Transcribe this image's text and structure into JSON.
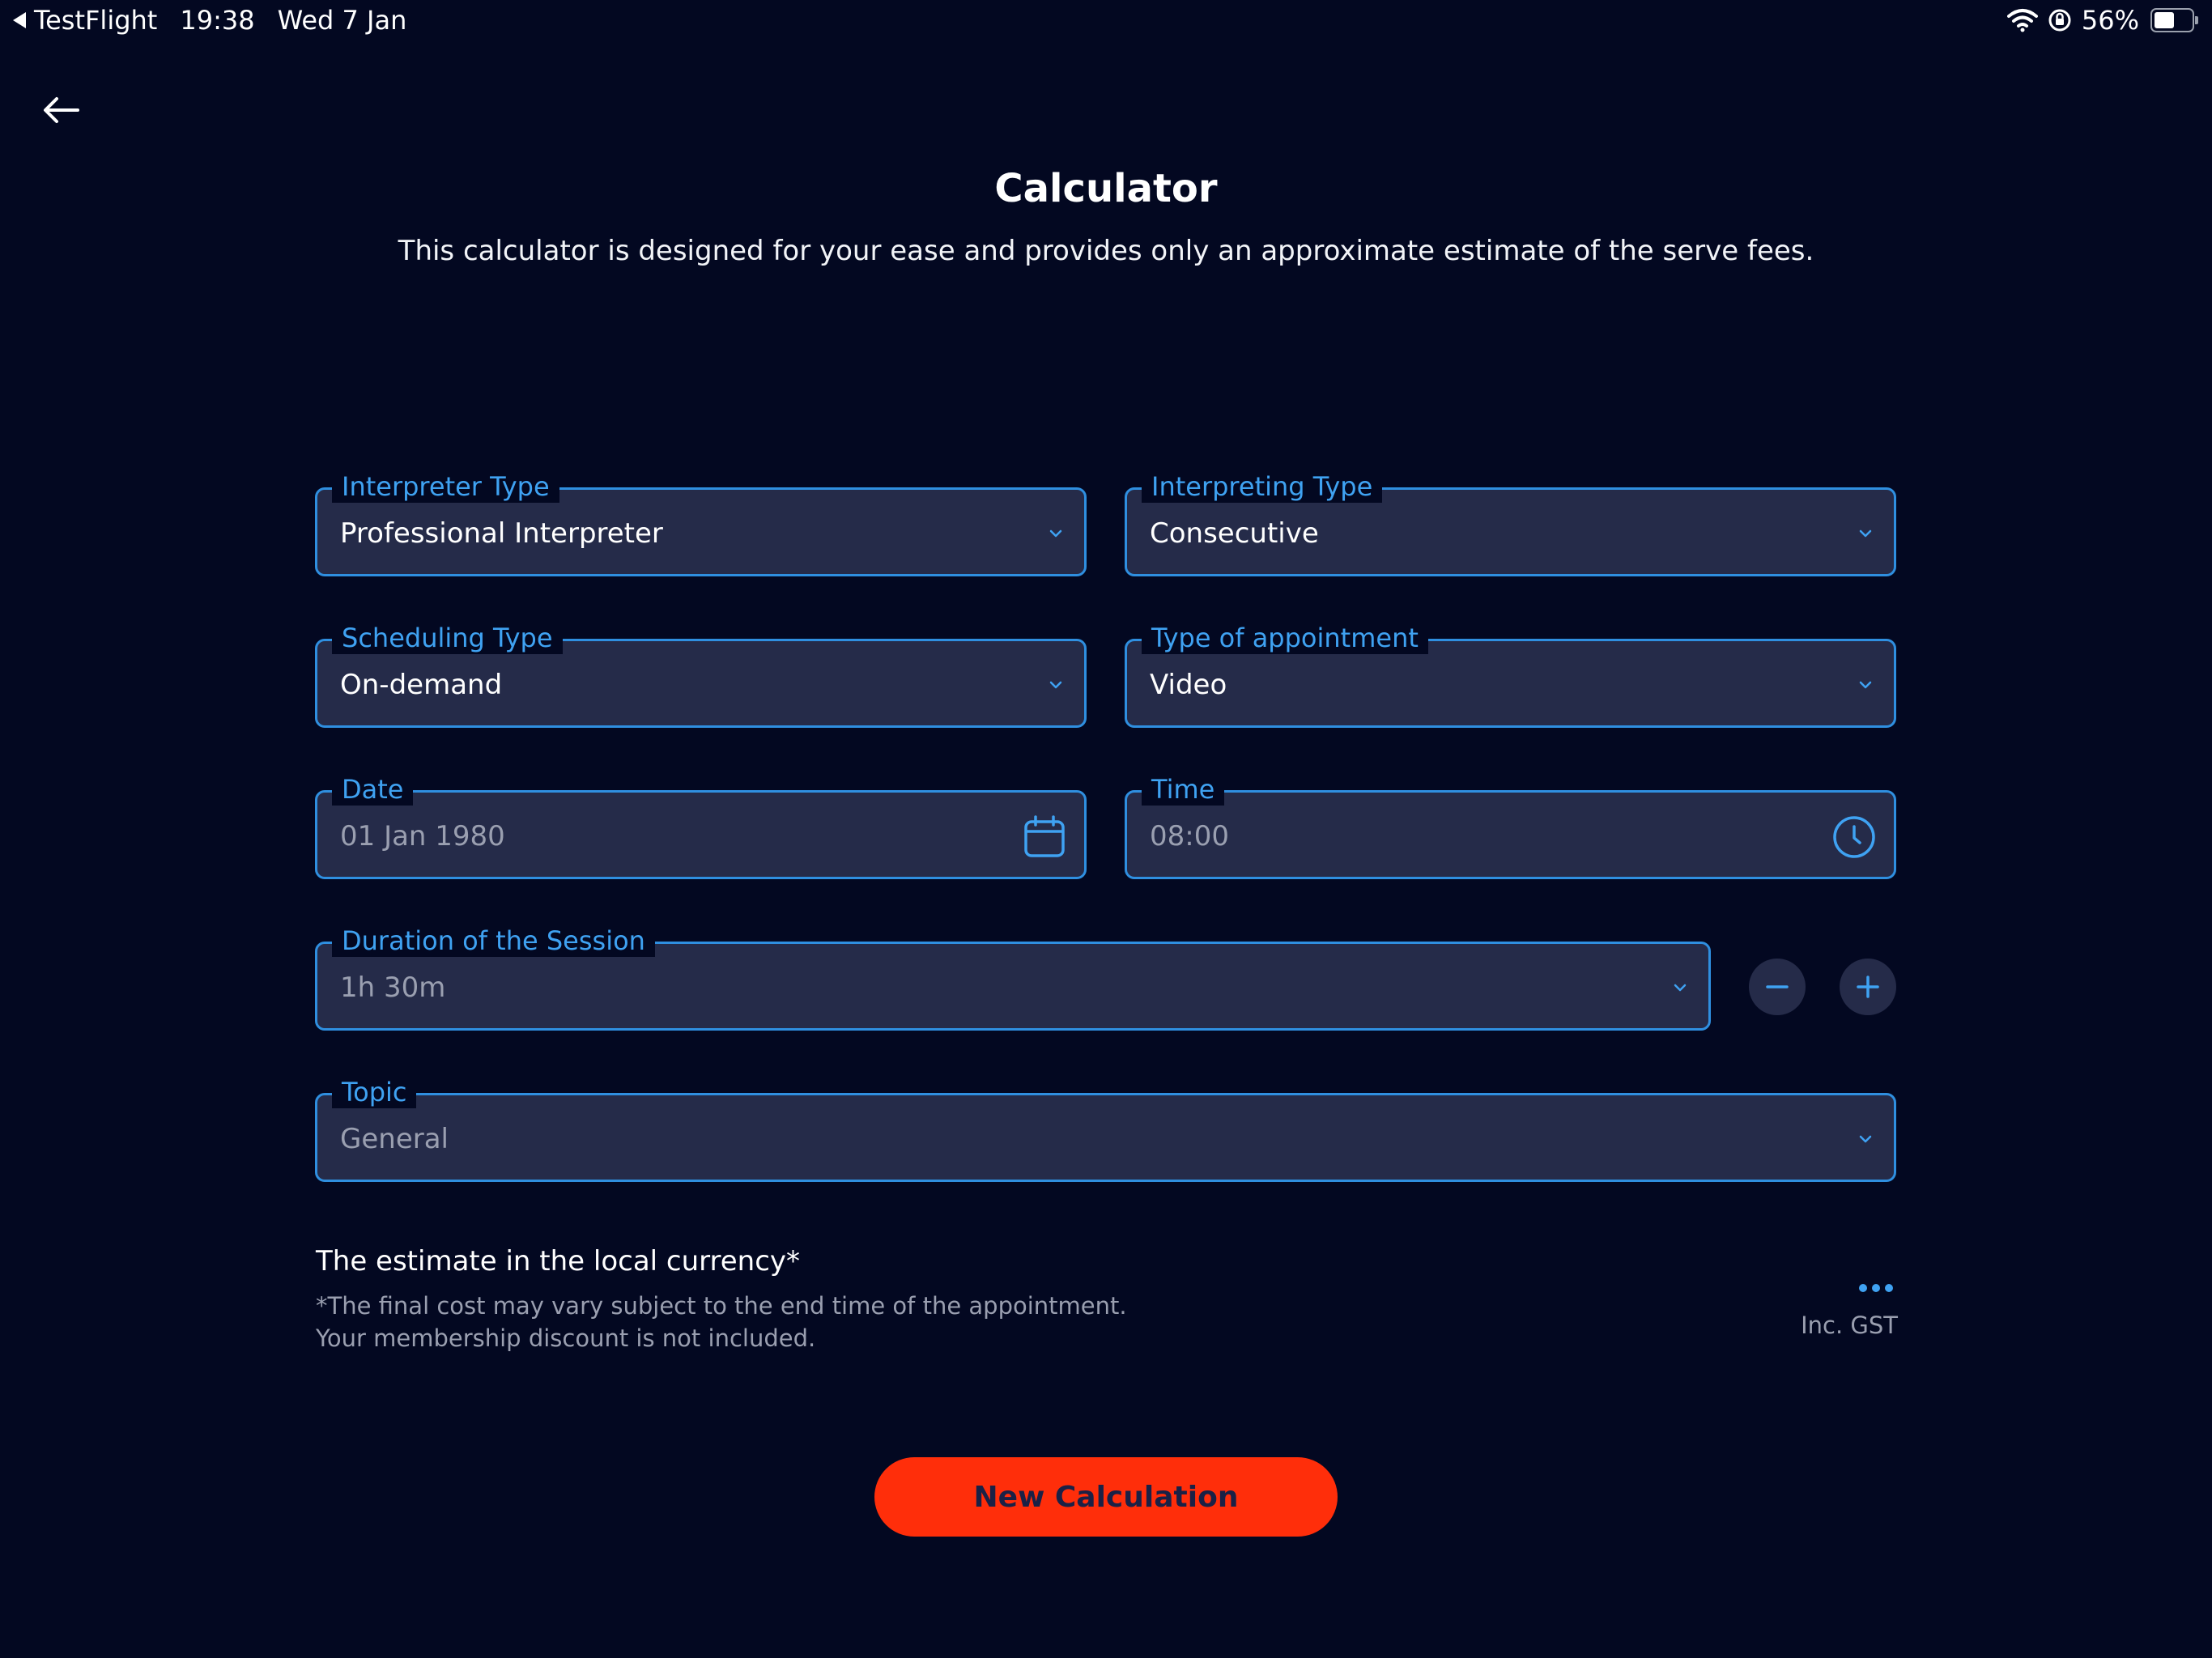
{
  "status_bar": {
    "back_app": "TestFlight",
    "time": "19:38",
    "date": "Wed 7 Jan",
    "battery": "56%"
  },
  "header": {
    "title": "Calculator",
    "subtitle": "This calculator is designed for your ease and provides only an approximate estimate of the serve fees."
  },
  "form": {
    "interpreter_type": {
      "label": "Interpreter Type",
      "value": "Professional Interpreter"
    },
    "interpreting_type": {
      "label": "Interpreting Type",
      "value": "Consecutive"
    },
    "scheduling_type": {
      "label": "Scheduling Type",
      "value": "On-demand"
    },
    "appointment_type": {
      "label": "Type of appointment",
      "value": "Video"
    },
    "date": {
      "label": "Date",
      "value": "01 Jan 1980"
    },
    "time": {
      "label": "Time",
      "value": "08:00"
    },
    "duration": {
      "label": "Duration of the Session",
      "value": "1h 30m"
    },
    "topic": {
      "label": "Topic",
      "value": "General"
    }
  },
  "estimate": {
    "title": "The estimate in the local currency*",
    "note_line1": "*The final cost may vary subject to the end time of the appointment.",
    "note_line2": "Your membership discount is not included.",
    "tax_label": "Inc. GST"
  },
  "actions": {
    "new_calculation": "New Calculation"
  },
  "colors": {
    "background": "#030821",
    "field_bg": "#252b49",
    "accent_blue": "#3fa2f2",
    "cta": "#ff2e0a"
  }
}
